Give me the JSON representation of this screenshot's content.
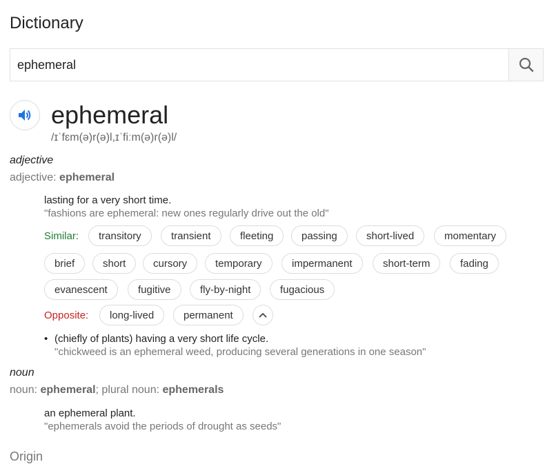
{
  "page": {
    "title": "Dictionary"
  },
  "search": {
    "value": "ephemeral",
    "icon": "search-icon"
  },
  "entry": {
    "speaker_icon": "speaker-icon",
    "word": "ephemeral",
    "phonetic": "/ɪˈfɛm(ə)r(ə)l,ɪˈfiːm(ə)r(ə)l/"
  },
  "adjective": {
    "pos": "adjective",
    "forms_prefix": "adjective: ",
    "forms_word": "ephemeral",
    "definition": "lasting for a very short time.",
    "example": "\"fashions are ephemeral: new ones regularly drive out the old\"",
    "similar_label": "Similar:",
    "similar": [
      "transitory",
      "transient",
      "fleeting",
      "passing",
      "short-lived",
      "momentary",
      "brief",
      "short",
      "cursory",
      "temporary",
      "impermanent",
      "short-term",
      "fading",
      "evanescent",
      "fugitive",
      "fly-by-night",
      "fugacious"
    ],
    "opposite_label": "Opposite:",
    "opposite": [
      "long-lived",
      "permanent"
    ],
    "sub_bullet": "•",
    "sub_definition": "(chiefly of plants) having a very short life cycle.",
    "sub_example": "\"chickweed is an ephemeral weed, producing several generations in one season\""
  },
  "noun": {
    "pos": "noun",
    "forms_prefix": "noun: ",
    "forms_word": "ephemeral",
    "forms_sep": "; plural noun: ",
    "forms_plural": "ephemerals",
    "definition": "an ephemeral plant.",
    "example": "\"ephemerals avoid the periods of drought as seeds\""
  },
  "origin": {
    "label": "Origin"
  },
  "colors": {
    "similar": "#1e7e34",
    "opposite": "#c5221f",
    "speaker": "#1a73e8"
  }
}
